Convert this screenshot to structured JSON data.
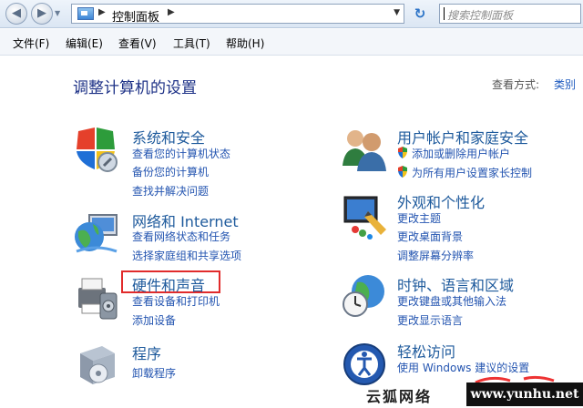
{
  "address_bar": {
    "back_symbol": "◀",
    "forward_symbol": "▶",
    "breadcrumb": "控制面板",
    "search_placeholder": "搜索控制面板"
  },
  "menu": [
    {
      "label": "文件(F)"
    },
    {
      "label": "编辑(E)"
    },
    {
      "label": "查看(V)"
    },
    {
      "label": "工具(T)"
    },
    {
      "label": "帮助(H)"
    }
  ],
  "main": {
    "title": "调整计算机的设置",
    "view_by_label": "查看方式:",
    "view_by_value": "类别"
  },
  "categories": {
    "system_security": {
      "title": "系统和安全",
      "links": [
        "查看您的计算机状态",
        "备份您的计算机",
        "查找并解决问题"
      ]
    },
    "network": {
      "title": "网络和 Internet",
      "links": [
        "查看网络状态和任务",
        "选择家庭组和共享选项"
      ]
    },
    "hardware": {
      "title": "硬件和声音",
      "links": [
        "查看设备和打印机",
        "添加设备"
      ]
    },
    "programs": {
      "title": "程序",
      "links": [
        "卸载程序"
      ]
    },
    "user_accounts": {
      "title": "用户帐户和家庭安全",
      "links": [
        "添加或删除用户帐户",
        "为所有用户设置家长控制"
      ]
    },
    "appearance": {
      "title": "外观和个性化",
      "links": [
        "更改主题",
        "更改桌面背景",
        "调整屏幕分辨率"
      ]
    },
    "clock_region": {
      "title": "时钟、语言和区域",
      "links": [
        "更改键盘或其他输入法",
        "更改显示语言"
      ]
    },
    "ease_access": {
      "title": "轻松访问",
      "links": [
        "使用 Windows 建议的设置"
      ]
    }
  },
  "watermark": {
    "text": "云狐网络",
    "url": "www.yunhu.net"
  },
  "colors": {
    "link": "#2354b0",
    "category_title": "#1e5a9c",
    "page_title": "#1e3287",
    "highlight_box": "#e12b2b"
  }
}
